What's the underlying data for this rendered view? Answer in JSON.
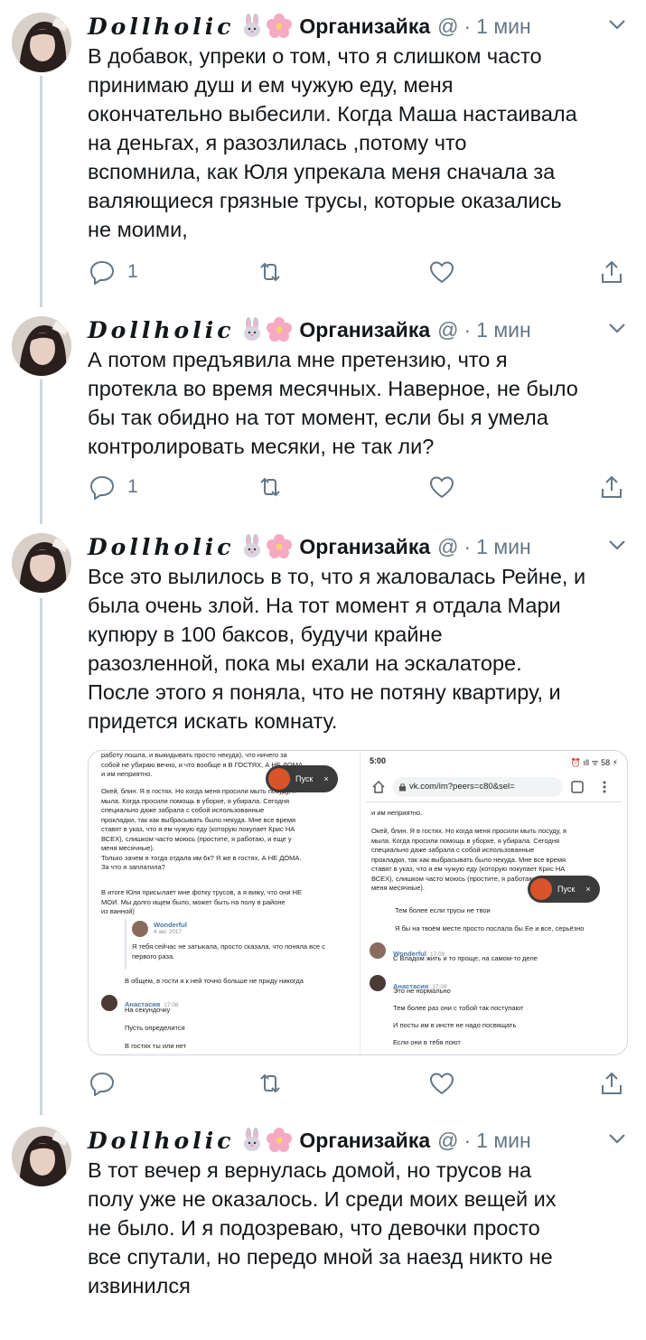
{
  "author": {
    "display_name_script": "Dollholic",
    "display_name_word": "Организайка",
    "handle": "@",
    "separator": "·",
    "emoji_1": "rabbit-emoji",
    "emoji_2": "cherry-blossom-emoji"
  },
  "tweets": [
    {
      "time": "1 мин",
      "text": "В добавок, упреки о том, что я слишком часто\nпринимаю душ и ем чужую еду, меня\nокончательно выбесили. Когда Маша настаивала\nна деньгах, я разозлилась ,потому что\nвспомнила, как Юля упрекала меня сначала за\nваляющиеся грязные трусы, которые оказались\nне моими,",
      "reply_count": "1"
    },
    {
      "time": "1 мин",
      "text": "А потом предъявила мне претензию, что я\nпротекла во время месячных. Наверное, не было\nбы так обидно на тот момент, если бы я умела\nконтролировать месяки, не так ли?",
      "reply_count": "1"
    },
    {
      "time": "1 мин",
      "text": "Все это вылилось в то, что я жаловалась Рейне, и\nбыла очень злой.  На тот момент я отдала Мари\nкупюру в 100 баксов, будучи крайне\nразозленной, пока мы ехали на эскалаторе.\nПосле этого я поняла, что не потяну квартиру, и\nпридется искать комнату.",
      "reply_count": ""
    },
    {
      "time": "1 мин",
      "text": "В тот вечер я вернулась домой, но трусов на\nполу уже не оказалось. И среди моих вещей их\nне было. И я подозреваю, что девочки просто\nвсе спутали, но передо мной за наезд никто не\nизвинился"
    }
  ],
  "media": {
    "left": {
      "top_lines": [
        "работу пошла, и выкидывать просто некуда), что ничего за",
        "собой не убираю вечно, и что вообще я В ГОСТЯХ, А НЕ ДОМА",
        "и им неприятно."
      ],
      "paragraph_1": [
        "Окей, блин. Я в гостях. Но когда меня просили мыть посуду, я",
        "мыла. Когда просили помощь в уборке, я убирала. Сегодня",
        "специально даже забрала с собой использованные",
        "прокладки, так как выбрасывать было некуда. Мне все время",
        "ставят в указ, что я ем чужую еду (которую покупает Крис НА",
        "ВСЕХ), слишком часто моюсь (простите, я работаю, и еще у",
        "меня месячные).",
        "Только зачем я тогда отдала им 6к? Я же в гостях, А НЕ ДОМА.",
        "За что я заплатила?"
      ],
      "paragraph_2": [
        "В итоге Юля присылает мне фотку трусов, а я вижу, что они НЕ",
        "МОИ. Мы долго ищем было, может быть на полу в районе",
        "из ванной)"
      ],
      "quote_name": "Wonderful",
      "quote_time": "4 авг 2017",
      "quote_text": [
        "Я тебя сейчас не затыкала, просто сказала, что поняла все с",
        "первого раза."
      ],
      "after_quote": "В общем, в гости я к ней точно больше не приду никогда",
      "msg_name": "Анастасия",
      "msg_time": "17:08",
      "msg_lines": [
        "На секундочку",
        "Пусть определится",
        "В гостях ты или нет"
      ],
      "pusk_label": "Пуск",
      "pusk_close": "×"
    },
    "right": {
      "status_time": "5:00",
      "status_icons": "⏰ ıll ᯤ 58 ⚡",
      "url": "vk.com/im?peers=c80&sel=",
      "top_line": "и им неприятно.",
      "paragraph": [
        "Окей, блин. Я в гостях. Но когда меня просили мыть посуду, я",
        "мыла. Когда просили помощь в уборке, я убирала. Сегодня",
        "специально даже забрала с собой использованные",
        "прокладки, так как выбрасывать было некуда. Мне все время",
        "ставят в указ, что я ем чужую еду (которую покупает Крис НА",
        "ВСЕХ), слишком часто моюсь (простите, я работаю, и еще у",
        "меня месячные)."
      ],
      "line_a": "Тем более если трусы не твои",
      "line_b": "Я бы на твоём месте просто послала бы Ее и все, серьёзно",
      "w_name": "Wonderful",
      "w_time": "17:09",
      "w_text": "С Владом жить и то проще, на самом-то деле",
      "a_name": "Анастасия",
      "a_time": "17:09",
      "a_lines": [
        "Это не нормально",
        "Тем более раз они с тобой так поступают",
        "И посты им в инсте не надо посвящать",
        "Если они в тебя поют"
      ],
      "pusk_label": "Пуск",
      "pusk_close": "×"
    }
  }
}
